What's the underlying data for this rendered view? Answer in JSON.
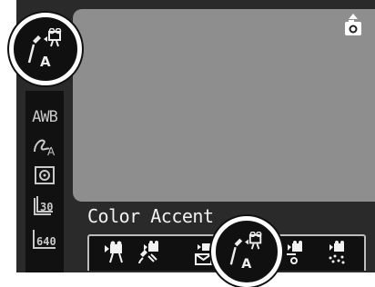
{
  "screen": {
    "caption": "Color Accent",
    "sidebar": {
      "white_balance_label": "AWB"
    },
    "icons": {
      "top_left": "color-accent-mode-icon",
      "top_right": "camera-record-mode-icon",
      "sidebar": [
        "awb-icon",
        "my-colors-icon",
        "metering-icon",
        "frame-rate-icon",
        "resolution-icon"
      ],
      "modes": [
        "standard-movie-icon",
        "color-accent-icon",
        "envelope-movie-icon",
        "color-accent-selected-icon",
        "color-swap-icon",
        "sparkle-movie-icon"
      ]
    },
    "colors": {
      "view_gray": "#8e8e8e",
      "frame_black": "#2a2a2a",
      "highlight_ring": "#ffffff"
    }
  },
  "sidebar_values": {
    "frame_rate": "30",
    "resolution": "640"
  }
}
